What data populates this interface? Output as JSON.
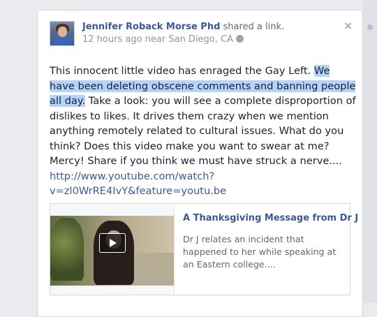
{
  "post": {
    "author": "Jennifer Roback Morse Phd",
    "action": " shared a link.",
    "time": "12 hours ago",
    "location_text": " near San Diego, CA",
    "privacy_icon": "globe-icon",
    "close_glyph": "×",
    "text_segments": {
      "part1": "This innocent little video has enraged the Gay Left. ",
      "highlighted": "We have been deleting obscene comments and banning people all day.",
      "part2": " Take a look: you will see a complete disproportion of dislikes to likes. It drives them crazy when we mention anything remotely related to cultural issues. What do you think? Does this video make you want to swear at me? Mercy! Share if you think we must have struck a nerve....",
      "link": "http://www.youtube.com/watch?v=zl0WrRE4IvY&feature=youtu.be"
    }
  },
  "link_preview": {
    "title": "A Thanksgiving Message from Dr J",
    "description": "Dr J relates an incident that happened to her while speaking at an Eastern college....",
    "play_icon": "play-icon"
  },
  "colors": {
    "link_blue": "#3b5998",
    "highlight": "#b3d4fc",
    "background": "#e9ebee"
  }
}
